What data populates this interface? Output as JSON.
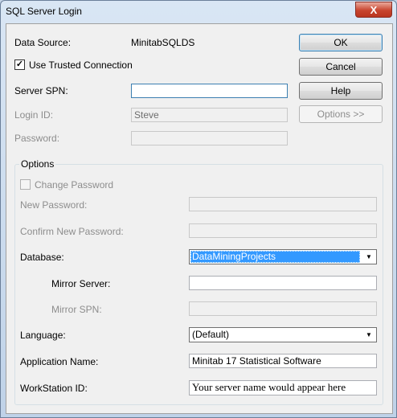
{
  "window": {
    "title": "SQL Server Login",
    "close_glyph": "X"
  },
  "login": {
    "data_source_label": "Data Source:",
    "data_source_value": "MinitabSQLDS",
    "trusted_label": "Use Trusted Connection",
    "trusted_checked": "✓",
    "server_spn_label": "Server SPN:",
    "server_spn_value": "",
    "login_id_label": "Login ID:",
    "login_id_value": "Steve",
    "password_label": "Password:",
    "password_value": ""
  },
  "buttons": {
    "ok": "OK",
    "cancel": "Cancel",
    "help": "Help",
    "options": "Options >>"
  },
  "options": {
    "group_title": "Options",
    "change_password_label": "Change Password",
    "new_password_label": "New Password:",
    "new_password_value": "",
    "confirm_password_label": "Confirm New Password:",
    "confirm_password_value": "",
    "database_label": "Database:",
    "database_value": "DataMiningProjects",
    "mirror_server_label": "Mirror Server:",
    "mirror_server_value": "",
    "mirror_spn_label": "Mirror SPN:",
    "mirror_spn_value": "",
    "language_label": "Language:",
    "language_value": "(Default)",
    "app_name_label": "Application Name:",
    "app_name_value": "Minitab 17 Statistical Software",
    "workstation_label": "WorkStation ID:",
    "workstation_value": "Your server name would appear here"
  },
  "icons": {
    "dropdown_arrow": "▼"
  }
}
